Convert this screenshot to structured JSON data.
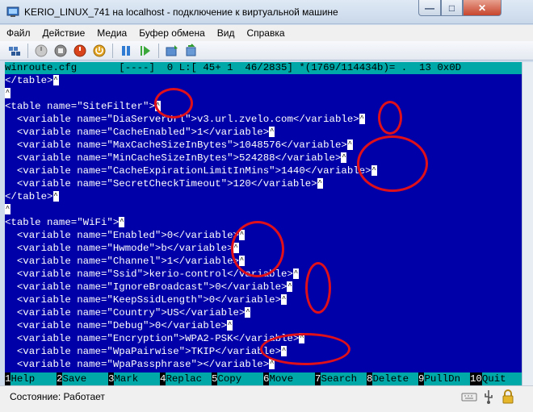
{
  "window": {
    "title": "KERIO_LINUX_741 на localhost - подключение к виртуальной машине",
    "min_glyph": "—",
    "max_glyph": "□",
    "close_glyph": "✕"
  },
  "menu": [
    "Файл",
    "Действие",
    "Медиа",
    "Буфер обмена",
    "Вид",
    "Справка"
  ],
  "toolbar_icons": [
    "ctrl-alt-del-icon",
    "start-icon",
    "turnoff-icon",
    "shutdown-icon",
    "power-icon",
    "pause-icon",
    "resume-icon",
    "snapshot-icon",
    "revert-icon"
  ],
  "editor": {
    "status_line": "winroute.cfg       [----]  0 L:[ 45+ 1  46/2835] *(1769/114434b)= .  13 0x0D",
    "caret_glyph": "^",
    "lines": [
      "</table>^",
      "^",
      "<table name=\"SiteFilter\">^",
      "  <variable name=\"DiaServerUrl\">v3.url.zvelo.com</variable>^",
      "  <variable name=\"CacheEnabled\">1</variable>^",
      "  <variable name=\"MaxCacheSizeInBytes\">1048576</variable>^",
      "  <variable name=\"MinCacheSizeInBytes\">524288</variable>^",
      "  <variable name=\"CacheExpirationLimitInMins\">1440</variable>^",
      "  <variable name=\"SecretCheckTimeout\">120</variable>^",
      "</table>^",
      "^",
      "<table name=\"WiFi\">^",
      "  <variable name=\"Enabled\">0</variable>^",
      "  <variable name=\"Hwmode\">b</variable>^",
      "  <variable name=\"Channel\">1</variable>^",
      "  <variable name=\"Ssid\">kerio-control</variable>^",
      "  <variable name=\"IgnoreBroadcast\">0</variable>^",
      "  <variable name=\"KeepSsidLength\">0</variable>^",
      "  <variable name=\"Country\">US</variable>^",
      "  <variable name=\"Debug\">0</variable>^",
      "  <variable name=\"Encryption\">WPA2-PSK</variable>^",
      "  <variable name=\"WpaPairwise\">TKIP</variable>^",
      "  <variable name=\"WpaPassphrase\"></variable>^"
    ],
    "function_keys": [
      {
        "num": "1",
        "label": "Help"
      },
      {
        "num": "2",
        "label": "Save"
      },
      {
        "num": "3",
        "label": "Mark"
      },
      {
        "num": "4",
        "label": "Replac"
      },
      {
        "num": "5",
        "label": "Copy"
      },
      {
        "num": "6",
        "label": "Move"
      },
      {
        "num": "7",
        "label": "Search"
      },
      {
        "num": "8",
        "label": "Delete"
      },
      {
        "num": "9",
        "label": "PullDn"
      },
      {
        "num": "10",
        "label": "Quit"
      }
    ]
  },
  "status": {
    "text": "Состояние: Работает"
  },
  "colors": {
    "terminal_bg": "#0000a8",
    "status_cyan": "#00a8a8",
    "annotation_red": "#e0101a"
  }
}
